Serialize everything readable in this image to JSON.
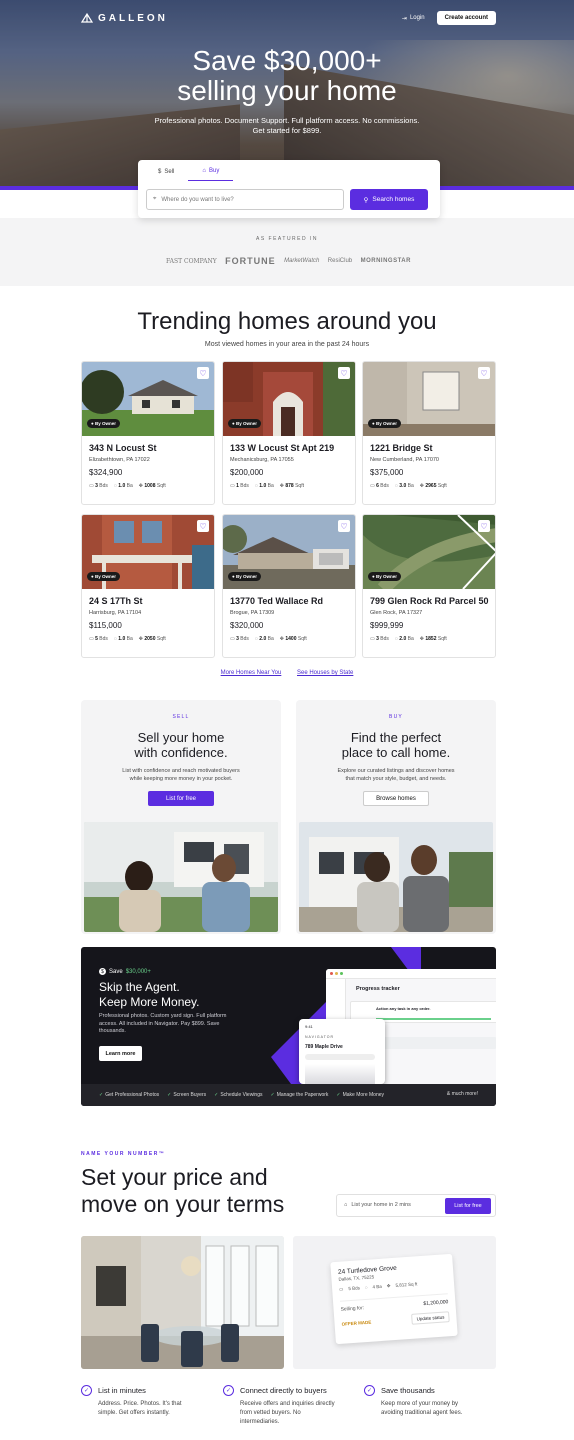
{
  "nav": {
    "brand": "GALLEON",
    "login": "Login",
    "create_account": "Create account"
  },
  "hero": {
    "title_line1": "Save $30,000+",
    "title_line2": "selling your home",
    "subtitle_line1": "Professional photos. Document Support. Full platform access. No commissions.",
    "subtitle_line2": "Get started for $899."
  },
  "search": {
    "tabs": [
      {
        "label": "Sell"
      },
      {
        "label": "Buy"
      }
    ],
    "active_tab": "Buy",
    "placeholder": "Where do you want to live?",
    "button": "Search homes"
  },
  "featured": {
    "label": "AS FEATURED IN",
    "logos": [
      "FAST COMPANY",
      "FORTUNE",
      "MarketWatch",
      "ResiClub",
      "MORNINGSTAR"
    ]
  },
  "trending": {
    "title": "Trending homes around you",
    "subtitle": "Most viewed homes in your area in the past 24 hours",
    "listings": [
      {
        "badge": "By Owner",
        "address": "343 N Locust St",
        "city": "Elizabethtown, PA 17022",
        "price": "$324,900",
        "beds": "3",
        "baths": "1.0",
        "sqft": "1008"
      },
      {
        "badge": "By Owner",
        "address": "133 W Locust St Apt 219",
        "city": "Mechanicsburg, PA 17055",
        "price": "$200,000",
        "beds": "1",
        "baths": "1.0",
        "sqft": "878"
      },
      {
        "badge": "By Owner",
        "address": "1221 Bridge St",
        "city": "New Cumberland, PA 17070",
        "price": "$375,000",
        "beds": "6",
        "baths": "3.0",
        "sqft": "2965"
      },
      {
        "badge": "By Owner",
        "address": "24 S 17Th St",
        "city": "Harrisburg, PA 17104",
        "price": "$115,000",
        "beds": "5",
        "baths": "1.0",
        "sqft": "2050"
      },
      {
        "badge": "By Owner",
        "address": "13770 Ted Wallace Rd",
        "city": "Brogue, PA 17309",
        "price": "$320,000",
        "beds": "3",
        "baths": "2.0",
        "sqft": "1400"
      },
      {
        "badge": "By Owner",
        "address": "799 Glen Rock Rd Parcel 50",
        "city": "Glen Rock, PA 17327",
        "price": "$999,999",
        "beds": "3",
        "baths": "2.0",
        "sqft": "1852"
      }
    ],
    "units": {
      "beds": "Bds",
      "baths": "Ba",
      "sqft": "Sqft"
    },
    "link_more": "More Homes Near You",
    "link_state": "See Houses by State"
  },
  "sell_panel": {
    "label": "SELL",
    "title_line1": "Sell your home",
    "title_line2": "with confidence.",
    "desc_line1": "List with confidence and reach motivated buyers",
    "desc_line2": "while keeping more money in your pocket.",
    "button": "List for free"
  },
  "buy_panel": {
    "label": "BUY",
    "title_line1": "Find the perfect",
    "title_line2": "place to call home.",
    "desc_line1": "Explore our curated listings and discover homes",
    "desc_line2": "that match your style, budget, and needs.",
    "button": "Browse homes"
  },
  "navigator": {
    "save_prefix": "Save",
    "save_amount": "$30,000+",
    "title_line1": "Skip the Agent.",
    "title_line2": "Keep More Money.",
    "desc": "Professional photos. Custom yard sign. Full platform access. All included in Navigator. Pay $899. Save thousands.",
    "button": "Learn more",
    "screen_title": "Progress tracker",
    "screen_task": "Action any task in any order.",
    "phone_brand": "NAVIGATOR",
    "phone_address": "789 Maple Drive",
    "features": [
      "Get Professional Photos",
      "Screen Buyers",
      "Schedule Viewings",
      "Manage the Paperwork",
      "Make More Money"
    ],
    "more": "& much more!"
  },
  "name_your_number": {
    "label": "NAME YOUR NUMBER™",
    "title_line1": "Set your price and",
    "title_line2": "move on your terms",
    "input_placeholder": "List your home in 2 mins",
    "button": "List for free",
    "mock": {
      "address": "24 Turtledove Grove",
      "city": "Dallas, TX, 75225",
      "beds": "5 Bds",
      "baths": "4 Ba",
      "sqft": "5,812 Sq ft",
      "selling_label": "Selling for:",
      "selling_value": "$1,200,000",
      "offer": "OFFER MADE",
      "update": "Update status"
    }
  },
  "features": [
    {
      "title": "List in minutes",
      "desc_line1": "Address. Price. Photos. It's that",
      "desc_line2": "simple. Get offers instantly."
    },
    {
      "title": "Connect directly to buyers",
      "desc_line1": "Receive offers and inquiries directly",
      "desc_line2": "from vetted buyers. No",
      "desc_line3": "intermediaries."
    },
    {
      "title": "Save thousands",
      "desc_line1": "Keep more of your money by",
      "desc_line2": "avoiding traditional agent fees."
    }
  ],
  "colors": {
    "accent": "#5b2de0",
    "dark": "#15151b",
    "check": "#6ad08b"
  }
}
